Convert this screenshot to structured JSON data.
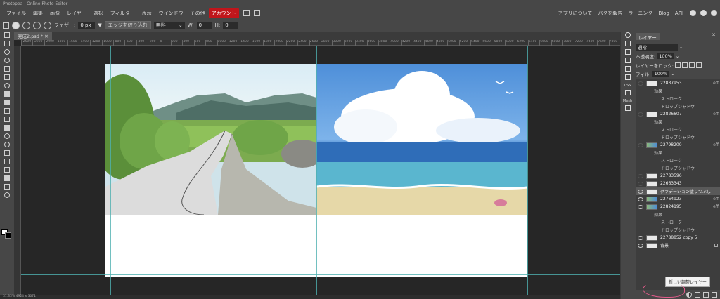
{
  "window": {
    "title": "Photopea | Online Photo Editor"
  },
  "menu": {
    "items": [
      "ファイル",
      "編集",
      "画像",
      "レイヤー",
      "選択",
      "フィルター",
      "表示",
      "ウインドウ",
      "その他"
    ],
    "account": "アカウント",
    "right_items": [
      "アプリについて",
      "バグを報告",
      "ラーニング",
      "Blog",
      "API"
    ]
  },
  "options": {
    "feather_label": "フェザー:",
    "feather_value": "0 px",
    "refine_edge": "エッジを絞り込む",
    "style_value": "無料",
    "w_label": "W:",
    "w_value": "0",
    "h_label": "H:",
    "h_value": "0"
  },
  "document": {
    "tab_title": "完成2.psd *"
  },
  "ruler_labels": [
    "-2500",
    "-2200",
    "-2000",
    "-1800",
    "-1600",
    "-1400",
    "-1200",
    "-1000",
    "-800",
    "-600",
    "-400",
    "-200",
    "0",
    "200",
    "400",
    "600",
    "800",
    "1000",
    "1200",
    "1400",
    "1600",
    "1800",
    "2000",
    "2200",
    "2400",
    "2600",
    "2800",
    "3000",
    "3200",
    "3400",
    "3600",
    "3800",
    "4000",
    "4200",
    "4400",
    "4600",
    "4800",
    "5000",
    "5200",
    "5400",
    "5600",
    "5800",
    "6000",
    "6200",
    "6400",
    "6600",
    "6800",
    "7000",
    "7200",
    "7400",
    "7600",
    "7800"
  ],
  "status": {
    "text": "31.33%  4924 x 3071"
  },
  "side_strip": {
    "css": "CSS",
    "mesh": "Mesh"
  },
  "layers_panel": {
    "tab": "レイヤー",
    "blend_mode": "通常",
    "opacity_label": "不透明度:",
    "opacity_value": "100%",
    "lock_label": "レイヤーをロック:",
    "fill_label": "フィル:",
    "fill_value": "100%",
    "layers": [
      {
        "name": "22837953",
        "type": "layer",
        "fx": "eff"
      },
      {
        "name": "効果",
        "type": "effects"
      },
      {
        "name": "ストローク",
        "type": "effect"
      },
      {
        "name": "ドロップシャドウ",
        "type": "effect"
      },
      {
        "name": "22826607",
        "type": "layer",
        "fx": "eff"
      },
      {
        "name": "効果",
        "type": "effects"
      },
      {
        "name": "ストローク",
        "type": "effect"
      },
      {
        "name": "ドロップシャドウ",
        "type": "effect"
      },
      {
        "name": "22798200",
        "type": "layer",
        "fx": "eff"
      },
      {
        "name": "効果",
        "type": "effects"
      },
      {
        "name": "ストローク",
        "type": "effect"
      },
      {
        "name": "ドロップシャドウ",
        "type": "effect"
      },
      {
        "name": "22783596",
        "type": "layer"
      },
      {
        "name": "22663343",
        "type": "layer"
      },
      {
        "name": "グラデーション塗りつぶし",
        "type": "adjust"
      },
      {
        "name": "22764923",
        "type": "layer",
        "fx": "eff"
      },
      {
        "name": "22824195",
        "type": "layer",
        "fx": "eff"
      },
      {
        "name": "効果",
        "type": "effects"
      },
      {
        "name": "ストローク",
        "type": "effect"
      },
      {
        "name": "ドロップシャドウ",
        "type": "effect"
      },
      {
        "name": "22788852 copy 5",
        "type": "layer"
      },
      {
        "name": "背景",
        "type": "background"
      }
    ],
    "tooltip": "新しい調整レイヤー"
  },
  "colors": {
    "account_red": "#c0151b",
    "guide": "#4fb0b0",
    "annotation_pink": "#e25b8a"
  }
}
